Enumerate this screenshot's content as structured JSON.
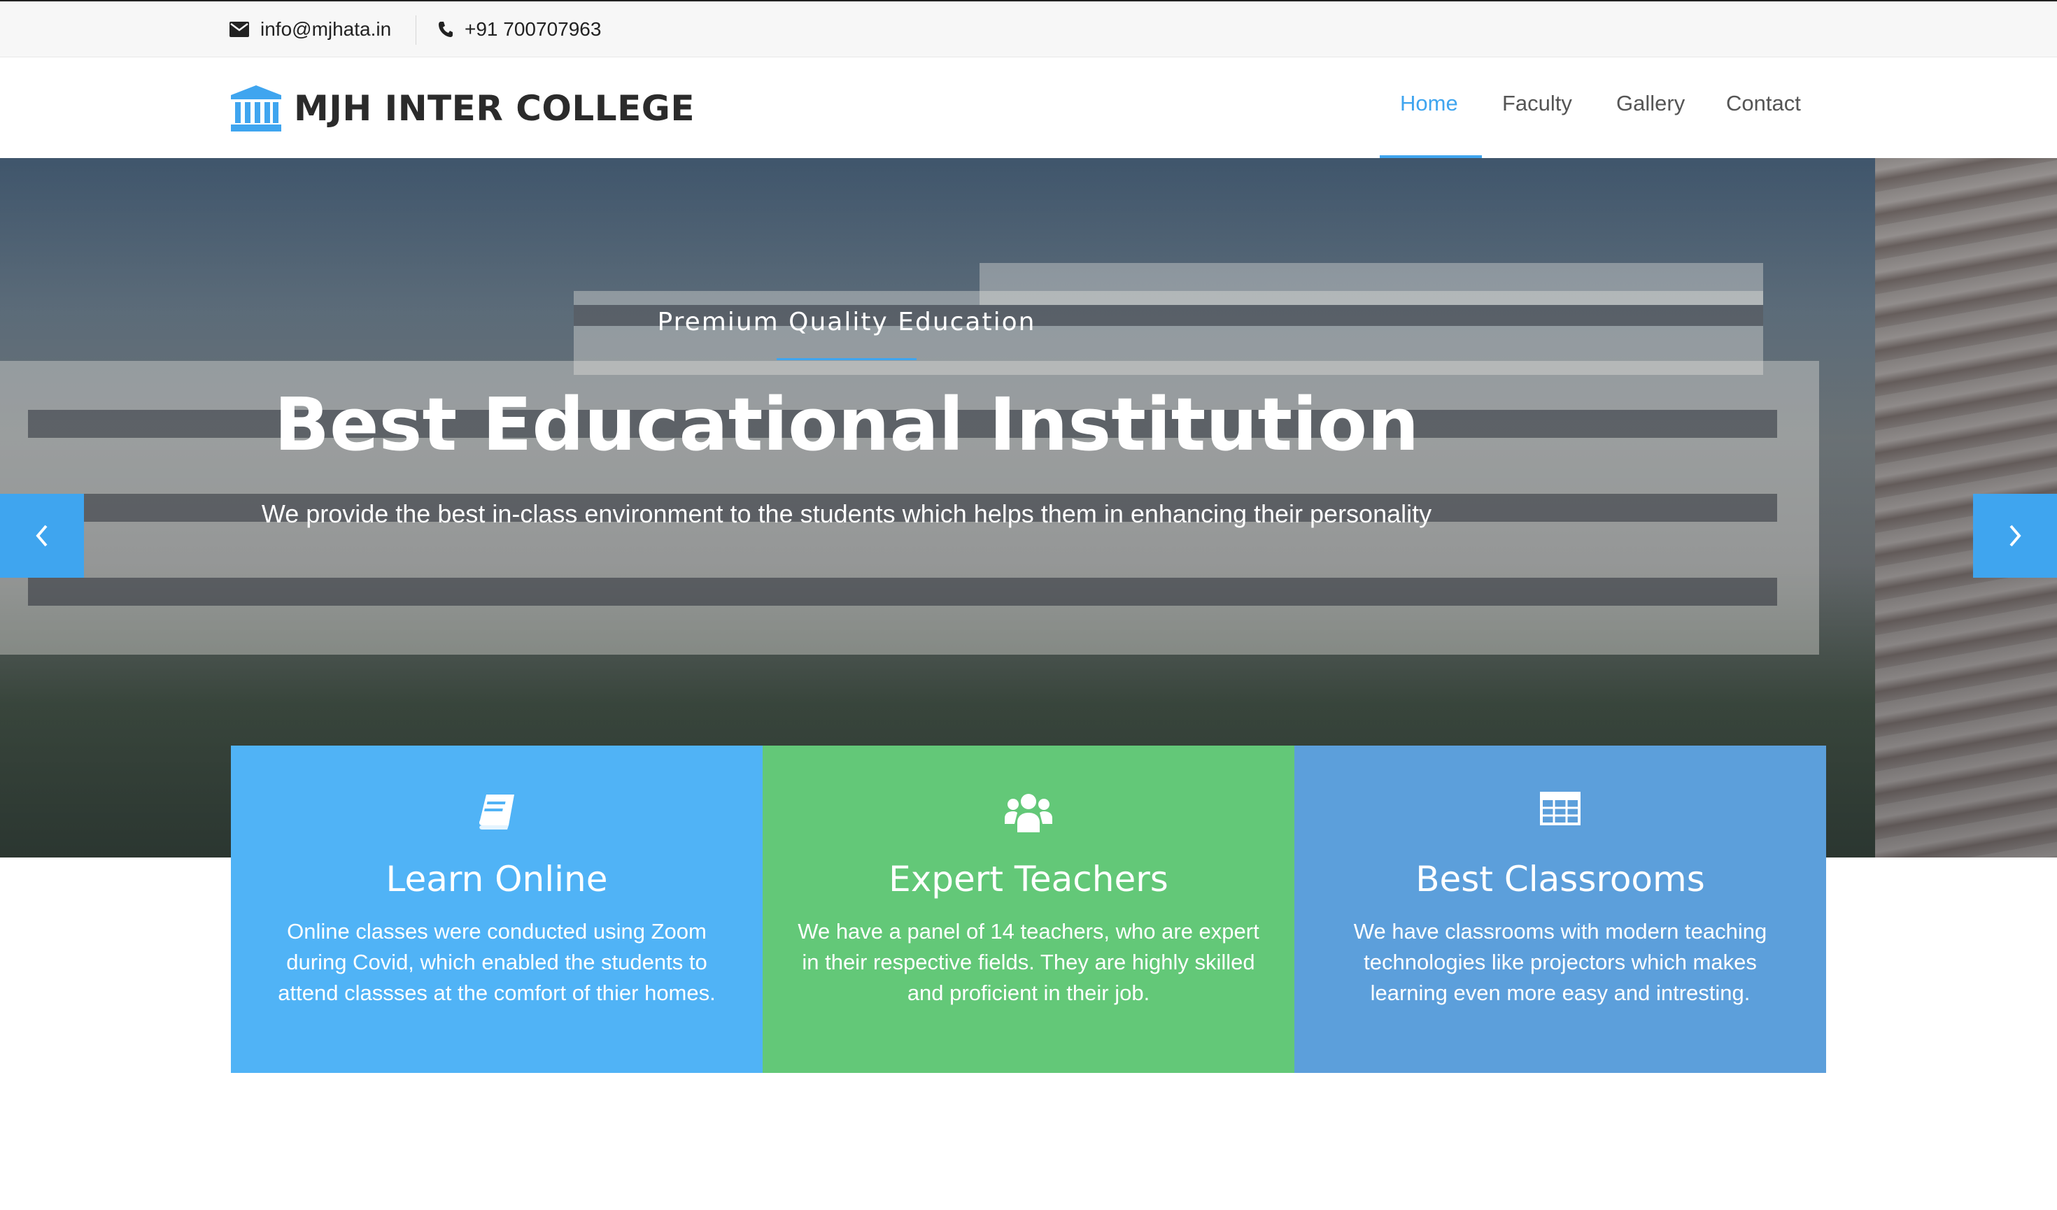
{
  "topbar": {
    "email": "info@mjhata.in",
    "phone": "+91 700707963"
  },
  "brand": {
    "name": "MJH INTER COLLEGE",
    "icon": "institution-icon",
    "color": "#3fa5ef"
  },
  "nav": {
    "items": [
      {
        "label": "Home",
        "active": true
      },
      {
        "label": "Faculty",
        "active": false
      },
      {
        "label": "Gallery",
        "active": false
      },
      {
        "label": "Contact",
        "active": false
      }
    ]
  },
  "hero": {
    "subtitle": "Premium Quality Education",
    "title": "Best Educational Institution",
    "description": "We provide the best in-class environment to the students which helps them in enhancing their personality",
    "prev_icon": "chevron-left-icon",
    "next_icon": "chevron-right-icon",
    "accent": "#3fa5ef"
  },
  "features": [
    {
      "icon": "book-icon",
      "title": "Learn Online",
      "description": "Online classes were conducted using Zoom during Covid, which enabled the students to attend classses at the comfort of thier homes.",
      "color": "#50b3f6"
    },
    {
      "icon": "users-icon",
      "title": "Expert Teachers",
      "description": "We have a panel of 14 teachers, who are expert in their respective fields. They are highly skilled and proficient in their job.",
      "color": "#63c878"
    },
    {
      "icon": "table-icon",
      "title": "Best Classrooms",
      "description": "We have classrooms with modern teaching technologies like projectors which makes learning even more easy and intresting.",
      "color": "#5c9fdb"
    }
  ]
}
